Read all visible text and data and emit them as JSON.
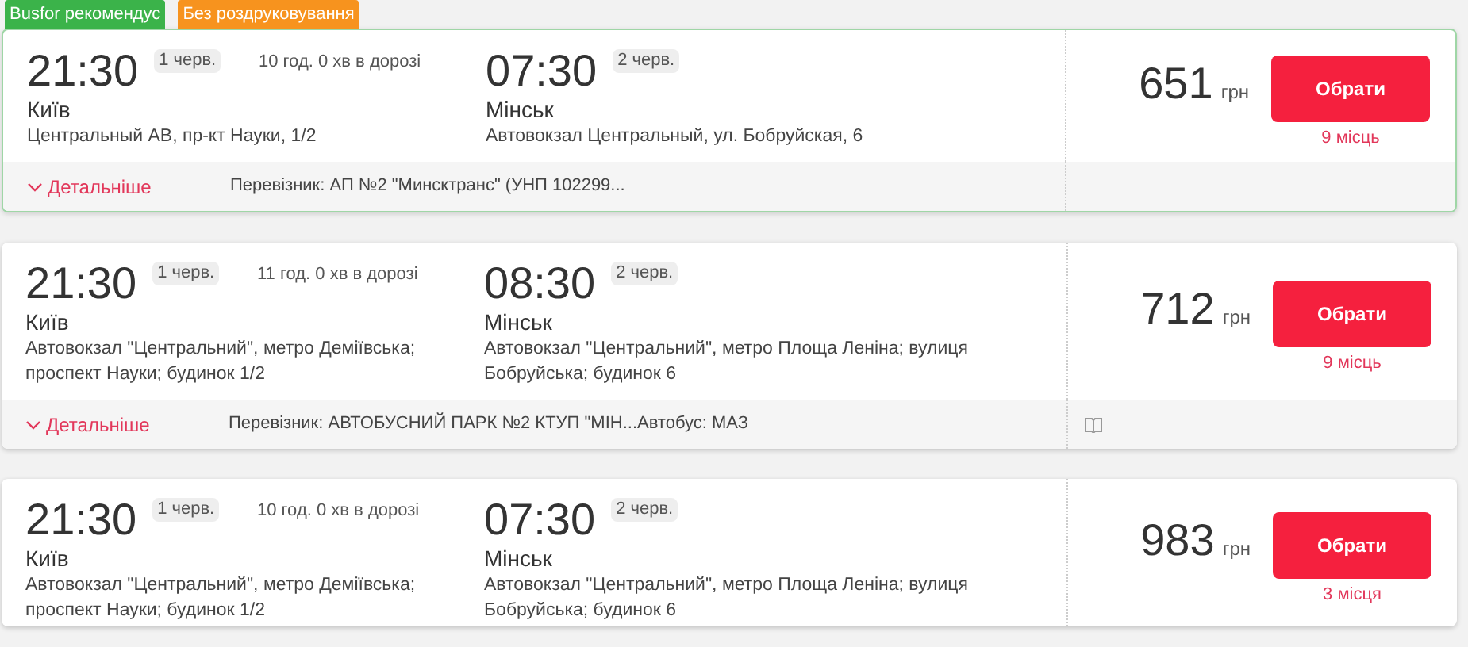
{
  "trips": [
    {
      "highlighted": true,
      "tags": [
        {
          "label": "Busfor рекомендус",
          "color": "#3bb34a"
        },
        {
          "label": "Без роздруковування",
          "color": "#f7931e"
        }
      ],
      "departure": {
        "time": "21:30",
        "date": "1 черв.",
        "city": "Київ",
        "address": "Центральный АВ, пр-кт Науки, 1/2"
      },
      "duration": "10 год. 0 хв в дорозі",
      "arrival": {
        "time": "07:30",
        "date": "2 черв.",
        "city": "Мінськ",
        "address": "Автовокзал Центральный, ул. Бобруйская, 6"
      },
      "price": "651",
      "currency": "грн",
      "button": "Обрати",
      "seats": "9 місць",
      "footer": {
        "details": "Детальніше",
        "carrier": "Перевізник: АП №2 \"Минсктранс\" (УНП 102299..."
      }
    },
    {
      "highlighted": false,
      "departure": {
        "time": "21:30",
        "date": "1 черв.",
        "city": "Київ",
        "address": "Автовокзал \"Центральний\", метро Деміївська; проспект Науки; будинок 1/2"
      },
      "duration": "11 год. 0 хв в дорозі",
      "arrival": {
        "time": "08:30",
        "date": "2 черв.",
        "city": "Мінськ",
        "address": "Автовокзал \"Центральний\", метро Площа Леніна; вулиця Бобруйська; будинок 6"
      },
      "price": "712",
      "currency": "грн",
      "button": "Обрати",
      "seats": "9 місць",
      "footer": {
        "details": "Детальніше",
        "carrier": "Перевізник: АВТОБУСНИЙ ПАРК №2 КТУП \"МІН...Автобус: МАЗ",
        "book_icon": true
      }
    },
    {
      "highlighted": false,
      "departure": {
        "time": "21:30",
        "date": "1 черв.",
        "city": "Київ",
        "address": "Автовокзал \"Центральний\", метро Деміївська; проспект Науки; будинок 1/2"
      },
      "duration": "10 год. 0 хв в дорозі",
      "arrival": {
        "time": "07:30",
        "date": "2 черв.",
        "city": "Мінськ",
        "address": "Автовокзал \"Центральний\", метро Площа Леніна; вулиця Бобруйська; будинок 6"
      },
      "price": "983",
      "currency": "грн",
      "button": "Обрати",
      "seats": "3 місця"
    }
  ]
}
